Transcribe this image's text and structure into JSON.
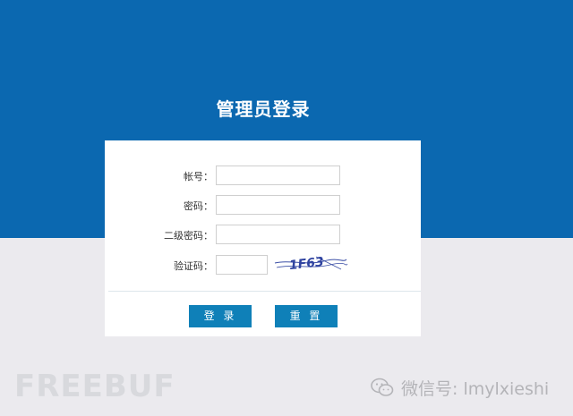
{
  "page": {
    "title": "管理员登录",
    "colors": {
      "header_bg": "#0b68b0",
      "page_bg": "#ebeaee",
      "button_bg": "#0f80b8"
    }
  },
  "form": {
    "account_label": "帐号：",
    "account_value": "",
    "password_label": "密码：",
    "password_value": "",
    "second_password_label": "二级密码：",
    "second_password_value": "",
    "captcha_label": "验证码：",
    "captcha_value": "",
    "captcha_image_text": "1F63"
  },
  "buttons": {
    "login_label": "登 录",
    "reset_label": "重 置"
  },
  "watermarks": {
    "freebuf_text": "FREEBUF",
    "wechat_icon": "wechat-icon",
    "wechat_text": "微信号: lmylxieshi"
  }
}
